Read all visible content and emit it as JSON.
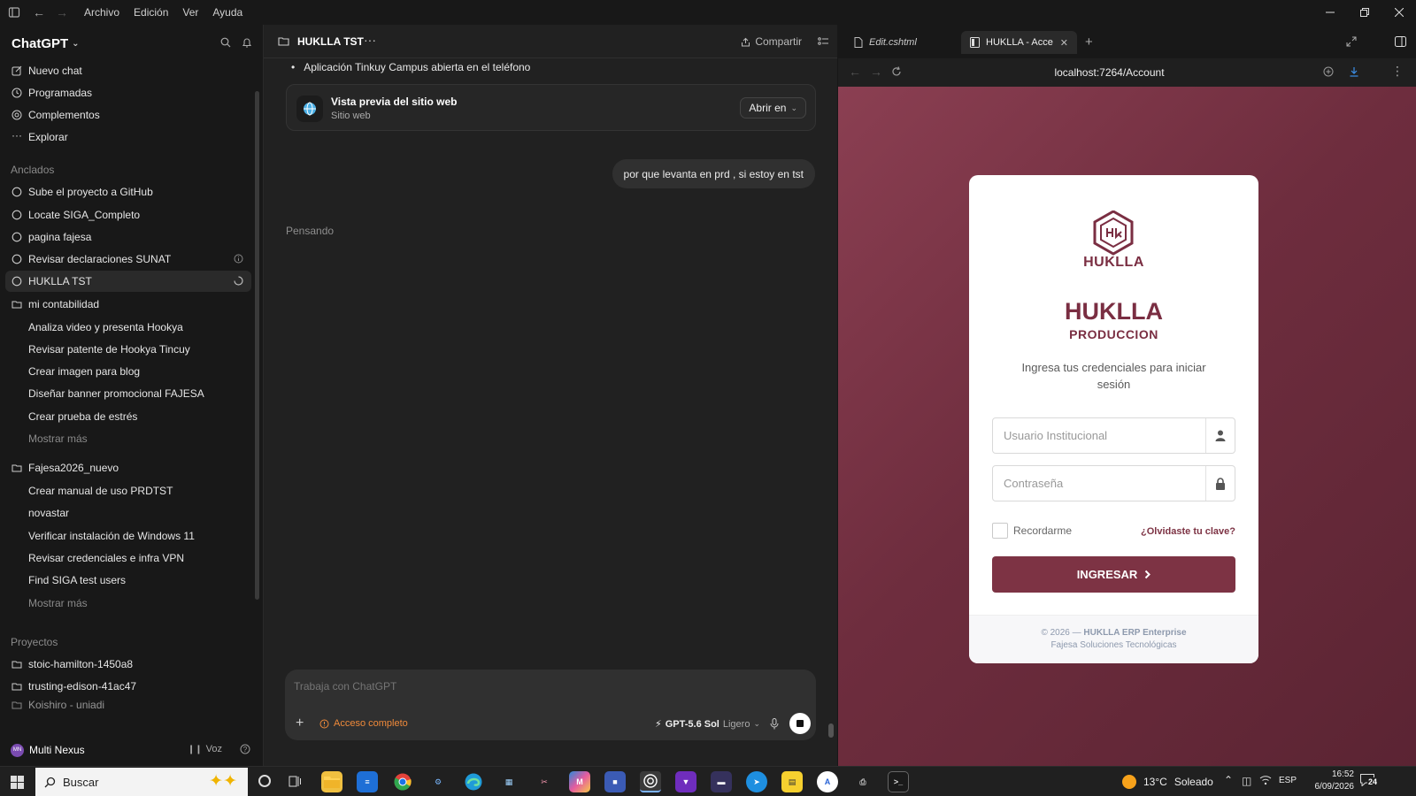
{
  "titlebar": {
    "menu": [
      "Archivo",
      "Edición",
      "Ver",
      "Ayuda"
    ]
  },
  "sidebar": {
    "brand": "ChatGPT",
    "nav": [
      "Nuevo chat",
      "Programadas",
      "Complementos",
      "Explorar"
    ],
    "pinned_heading": "Anclados",
    "pinned": [
      "Sube el proyecto a GitHub",
      "Locate SIGA_Completo",
      "pagina fajesa",
      "Revisar declaraciones SUNAT",
      "HUKLLA TST"
    ],
    "folder1": {
      "name": "mi contabilidad",
      "items": [
        "Analiza video y presenta Hookya",
        "Revisar patente de Hookya Tincuy",
        "Crear imagen para blog",
        "Diseñar banner promocional FAJESA",
        "Crear prueba de estrés"
      ],
      "more": "Mostrar más"
    },
    "folder2": {
      "name": "Fajesa2026_nuevo",
      "items": [
        "Crear manual de uso PRDTST",
        "novastar",
        "Verificar instalación de Windows 11",
        "Revisar credenciales e infra VPN",
        "Find SIGA test users"
      ],
      "more": "Mostrar más"
    },
    "projects_heading": "Proyectos",
    "projects": [
      "stoic-hamilton-1450a8",
      "trusting-edison-41ac47",
      "Koishiro - uniadi"
    ],
    "user": {
      "initials": "MN",
      "name": "Multi Nexus",
      "voice_label": "Voz"
    }
  },
  "chat": {
    "title": "HUKLLA TST",
    "share_label": "Compartir",
    "bullet": "Aplicación Tinkuy Campus abierta en el teléfono",
    "preview_card": {
      "title": "Vista previa del sitio web",
      "subtitle": "Sitio web",
      "open_label": "Abrir en"
    },
    "user_message": "por que levanta en prd , si estoy en tst",
    "thinking": "Pensando",
    "composer": {
      "placeholder": "Trabaja con ChatGPT",
      "access_label": "Acceso completo",
      "model_label": "GPT-5.6 Sol",
      "model_mode": "Ligero"
    }
  },
  "browser": {
    "tabs": [
      {
        "label": "Edit.cshtml"
      },
      {
        "label": "HUKLLA - Acce"
      }
    ],
    "url": "localhost:7264/Account",
    "login": {
      "logo_word": "HUKLLA",
      "title": "HUKLLA",
      "environment": "PRODUCCION",
      "instructions_line1": "Ingresa tus credenciales para iniciar",
      "instructions_line2": "sesión",
      "username_placeholder": "Usuario Institucional",
      "password_placeholder": "Contraseña",
      "remember_label": "Recordarme",
      "forgot_label": "¿Olvidaste tu clave?",
      "submit_label": "INGRESAR",
      "footer_prefix": "© 2026 — ",
      "footer_brand": "HUKLLA ERP Enterprise",
      "footer_line2": "Fajesa Soluciones Tecnológicas"
    },
    "brand_color": "#7d3344"
  },
  "taskbar": {
    "search_placeholder": "Buscar",
    "weather": "13°C",
    "weather_desc": "Soleado",
    "lang": "ESP",
    "time": "16:52",
    "date": "6/09/2026",
    "notifications": "24"
  }
}
